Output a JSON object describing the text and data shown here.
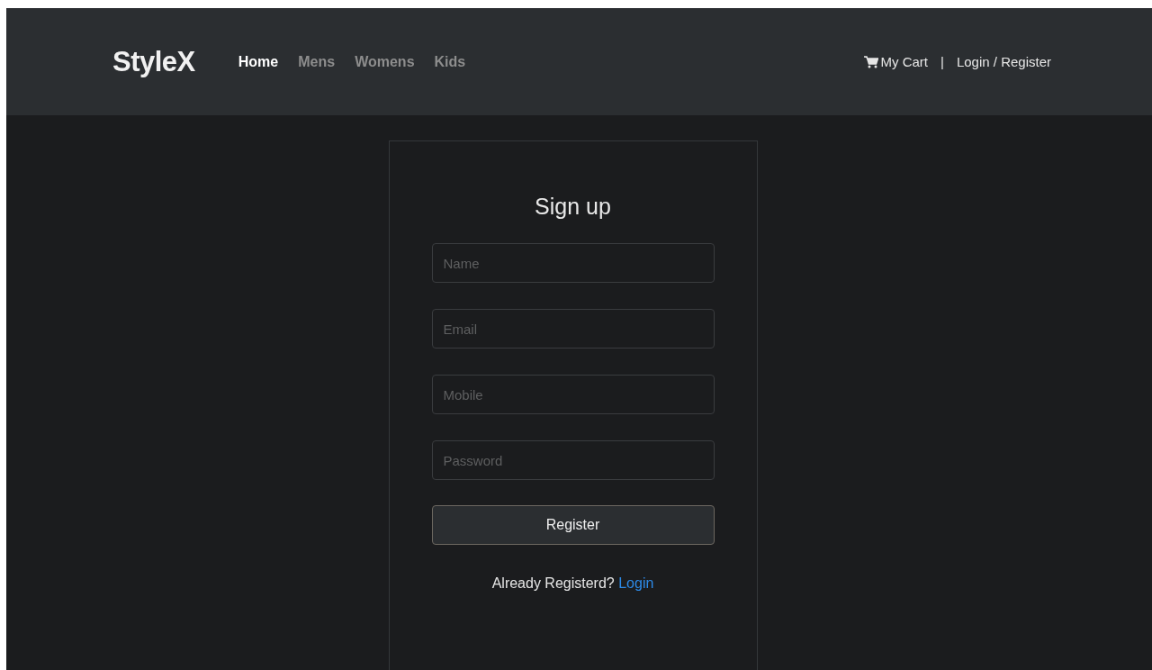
{
  "brand": "StyleX",
  "nav": [
    {
      "label": "Home",
      "selected": true
    },
    {
      "label": "Mens",
      "selected": false
    },
    {
      "label": "Womens",
      "selected": false
    },
    {
      "label": "Kids",
      "selected": false
    }
  ],
  "cart": "My Cart",
  "separator": "|",
  "account": "Login / Register",
  "form": {
    "title": "Sign up",
    "fields": [
      {
        "placeholder": "Name"
      },
      {
        "placeholder": "Email"
      },
      {
        "placeholder": "Mobile"
      },
      {
        "placeholder": "Password"
      }
    ],
    "button": "Register",
    "prompt": "Already Registerd?",
    "link": "Login"
  }
}
